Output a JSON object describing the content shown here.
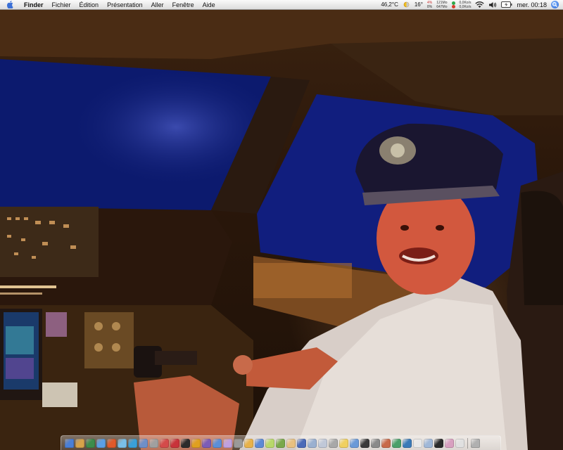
{
  "menubar": {
    "app_name": "Finder",
    "menus": [
      "Fichier",
      "Édition",
      "Présentation",
      "Aller",
      "Fenêtre",
      "Aide"
    ],
    "cpu_temp": "46,2°C",
    "weather_temp": "16°",
    "cpu_usage": "4%",
    "cpu_usage_2": "8%",
    "memory_used": "121Mo",
    "memory_free": "647Mo",
    "net_up": "0,0Ko/s",
    "net_down": "0,0Ko/s",
    "clock": "mer. 00:18",
    "icons": [
      "apple-icon",
      "weather-sun-icon",
      "wifi-icon",
      "volume-icon",
      "battery-icon",
      "spotlight-icon"
    ]
  },
  "desktop": {
    "wallpaper_subject": "cockpit-photo"
  },
  "dock": {
    "icons": [
      "finder-icon",
      "dashboard-icon",
      "people-icon",
      "globe-icon",
      "game-icon",
      "chat-icon",
      "skype-icon",
      "safari-icon",
      "network-icon",
      "calendar-icon",
      "pdf-icon",
      "terminal-icon",
      "butterfly-icon",
      "image-icon",
      "mail-icon",
      "graphic-icon",
      "settings-icon",
      "bird-icon",
      "folder-icon",
      "flower-icon",
      "photo-icon",
      "pencil-icon",
      "compass-icon",
      "airport-icon",
      "email-icon",
      "trash-small-icon",
      "sparkle-icon",
      "search-icon",
      "grid-icon",
      "gear-icon",
      "photo2-icon",
      "lens-icon",
      "earth-icon",
      "book-icon",
      "airplane-icon",
      "hq-icon",
      "music-icon",
      "clock-icon",
      "trash-icon"
    ],
    "colors": [
      "#4a7fd6",
      "#d6a34a",
      "#3c8c4b",
      "#5aa0e6",
      "#e05a2a",
      "#7ac0e8",
      "#3aa0d8",
      "#6f8fc8",
      "#a0a0a0",
      "#d44a4a",
      "#c8333a",
      "#2b2b2b",
      "#e0a020",
      "#7c5cb8",
      "#5b8fd8",
      "#c0a0e0",
      "#9a9a9a",
      "#e8b24a",
      "#5c8ad6",
      "#b8d86a",
      "#7aa84a",
      "#e8c080",
      "#4a6ab8",
      "#9ab0d0",
      "#c0c8d8",
      "#a8a8a8",
      "#f0d060",
      "#6a9ad8",
      "#3a3a3a",
      "#8a8a8a",
      "#c86a4a",
      "#4aa06a",
      "#3a7ab8",
      "#e8e8e8",
      "#a0b8d8",
      "#2a2a2a",
      "#d8a0c0",
      "#e0e0e0",
      "#b0b0b0"
    ]
  }
}
